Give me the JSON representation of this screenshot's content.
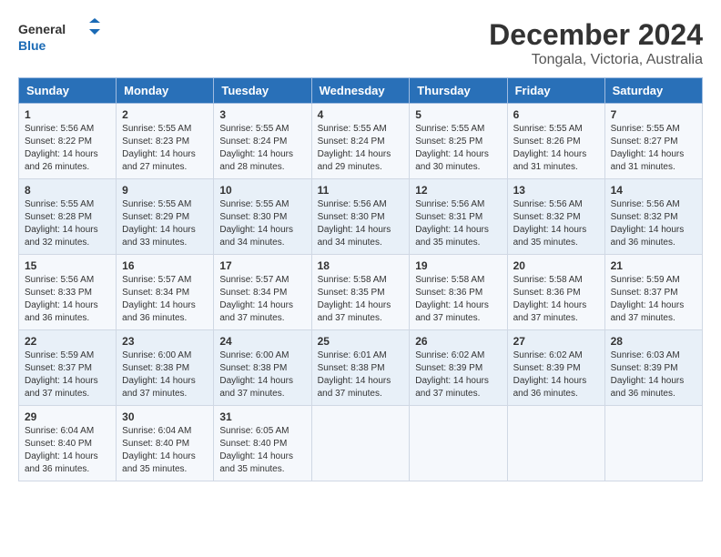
{
  "logo": {
    "line1": "General",
    "line2": "Blue"
  },
  "title": "December 2024",
  "subtitle": "Tongala, Victoria, Australia",
  "days_header": [
    "Sunday",
    "Monday",
    "Tuesday",
    "Wednesday",
    "Thursday",
    "Friday",
    "Saturday"
  ],
  "weeks": [
    [
      {
        "day": "1",
        "sunrise": "5:56 AM",
        "sunset": "8:22 PM",
        "daylight": "14 hours and 26 minutes."
      },
      {
        "day": "2",
        "sunrise": "5:55 AM",
        "sunset": "8:23 PM",
        "daylight": "14 hours and 27 minutes."
      },
      {
        "day": "3",
        "sunrise": "5:55 AM",
        "sunset": "8:24 PM",
        "daylight": "14 hours and 28 minutes."
      },
      {
        "day": "4",
        "sunrise": "5:55 AM",
        "sunset": "8:24 PM",
        "daylight": "14 hours and 29 minutes."
      },
      {
        "day": "5",
        "sunrise": "5:55 AM",
        "sunset": "8:25 PM",
        "daylight": "14 hours and 30 minutes."
      },
      {
        "day": "6",
        "sunrise": "5:55 AM",
        "sunset": "8:26 PM",
        "daylight": "14 hours and 31 minutes."
      },
      {
        "day": "7",
        "sunrise": "5:55 AM",
        "sunset": "8:27 PM",
        "daylight": "14 hours and 31 minutes."
      }
    ],
    [
      {
        "day": "8",
        "sunrise": "5:55 AM",
        "sunset": "8:28 PM",
        "daylight": "14 hours and 32 minutes."
      },
      {
        "day": "9",
        "sunrise": "5:55 AM",
        "sunset": "8:29 PM",
        "daylight": "14 hours and 33 minutes."
      },
      {
        "day": "10",
        "sunrise": "5:55 AM",
        "sunset": "8:30 PM",
        "daylight": "14 hours and 34 minutes."
      },
      {
        "day": "11",
        "sunrise": "5:56 AM",
        "sunset": "8:30 PM",
        "daylight": "14 hours and 34 minutes."
      },
      {
        "day": "12",
        "sunrise": "5:56 AM",
        "sunset": "8:31 PM",
        "daylight": "14 hours and 35 minutes."
      },
      {
        "day": "13",
        "sunrise": "5:56 AM",
        "sunset": "8:32 PM",
        "daylight": "14 hours and 35 minutes."
      },
      {
        "day": "14",
        "sunrise": "5:56 AM",
        "sunset": "8:32 PM",
        "daylight": "14 hours and 36 minutes."
      }
    ],
    [
      {
        "day": "15",
        "sunrise": "5:56 AM",
        "sunset": "8:33 PM",
        "daylight": "14 hours and 36 minutes."
      },
      {
        "day": "16",
        "sunrise": "5:57 AM",
        "sunset": "8:34 PM",
        "daylight": "14 hours and 36 minutes."
      },
      {
        "day": "17",
        "sunrise": "5:57 AM",
        "sunset": "8:34 PM",
        "daylight": "14 hours and 37 minutes."
      },
      {
        "day": "18",
        "sunrise": "5:58 AM",
        "sunset": "8:35 PM",
        "daylight": "14 hours and 37 minutes."
      },
      {
        "day": "19",
        "sunrise": "5:58 AM",
        "sunset": "8:36 PM",
        "daylight": "14 hours and 37 minutes."
      },
      {
        "day": "20",
        "sunrise": "5:58 AM",
        "sunset": "8:36 PM",
        "daylight": "14 hours and 37 minutes."
      },
      {
        "day": "21",
        "sunrise": "5:59 AM",
        "sunset": "8:37 PM",
        "daylight": "14 hours and 37 minutes."
      }
    ],
    [
      {
        "day": "22",
        "sunrise": "5:59 AM",
        "sunset": "8:37 PM",
        "daylight": "14 hours and 37 minutes."
      },
      {
        "day": "23",
        "sunrise": "6:00 AM",
        "sunset": "8:38 PM",
        "daylight": "14 hours and 37 minutes."
      },
      {
        "day": "24",
        "sunrise": "6:00 AM",
        "sunset": "8:38 PM",
        "daylight": "14 hours and 37 minutes."
      },
      {
        "day": "25",
        "sunrise": "6:01 AM",
        "sunset": "8:38 PM",
        "daylight": "14 hours and 37 minutes."
      },
      {
        "day": "26",
        "sunrise": "6:02 AM",
        "sunset": "8:39 PM",
        "daylight": "14 hours and 37 minutes."
      },
      {
        "day": "27",
        "sunrise": "6:02 AM",
        "sunset": "8:39 PM",
        "daylight": "14 hours and 36 minutes."
      },
      {
        "day": "28",
        "sunrise": "6:03 AM",
        "sunset": "8:39 PM",
        "daylight": "14 hours and 36 minutes."
      }
    ],
    [
      {
        "day": "29",
        "sunrise": "6:04 AM",
        "sunset": "8:40 PM",
        "daylight": "14 hours and 36 minutes."
      },
      {
        "day": "30",
        "sunrise": "6:04 AM",
        "sunset": "8:40 PM",
        "daylight": "14 hours and 35 minutes."
      },
      {
        "day": "31",
        "sunrise": "6:05 AM",
        "sunset": "8:40 PM",
        "daylight": "14 hours and 35 minutes."
      },
      null,
      null,
      null,
      null
    ]
  ]
}
